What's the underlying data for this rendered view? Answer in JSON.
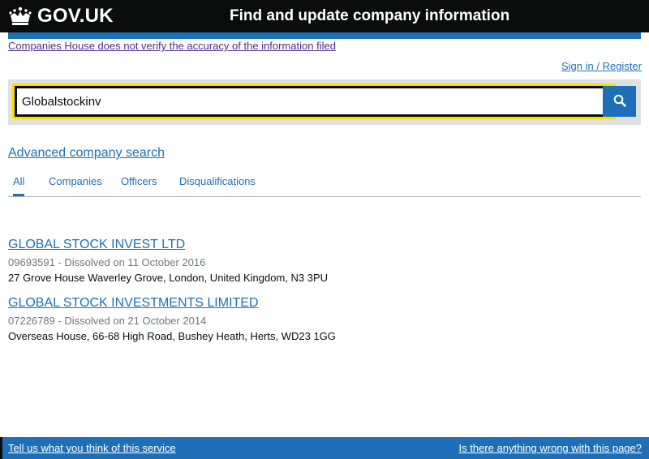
{
  "header": {
    "logo_text": "GOV.UK",
    "service_name": "Find and update company information"
  },
  "disclaimer": "Companies House does not verify the accuracy of the information filed",
  "account": {
    "sign_in_label": "Sign in / Register"
  },
  "search": {
    "value": "Globalstockinv",
    "button_icon": "search-icon"
  },
  "advanced_search_label": "Advanced company search",
  "tabs": [
    {
      "label": "All",
      "active": true
    },
    {
      "label": "Companies",
      "active": false
    },
    {
      "label": "Officers",
      "active": false
    },
    {
      "label": "Disqualifications",
      "active": false
    }
  ],
  "results": [
    {
      "title": "GLOBAL STOCK INVEST LTD",
      "meta": "09693591 - Dissolved on 11 October 2016",
      "address": "27 Grove House Waverley Grove, London, United Kingdom, N3 3PU"
    },
    {
      "title": "GLOBAL STOCK INVESTMENTS LIMITED",
      "meta": "07226789 - Dissolved on 21 October 2014",
      "address": "Overseas House, 66-68 High Road, Bushey Heath, Herts, WD23 1GG"
    }
  ],
  "footer": {
    "feedback_label": "Tell us what you think of this service",
    "report_label": "Is there anything wrong with this page?"
  },
  "colors": {
    "header_bg": "#0b0c0c",
    "brand_blue": "#1d70b8",
    "focus_yellow": "#ffdd00",
    "visited_link": "#4c2c92",
    "search_panel": "#dee0e2"
  }
}
